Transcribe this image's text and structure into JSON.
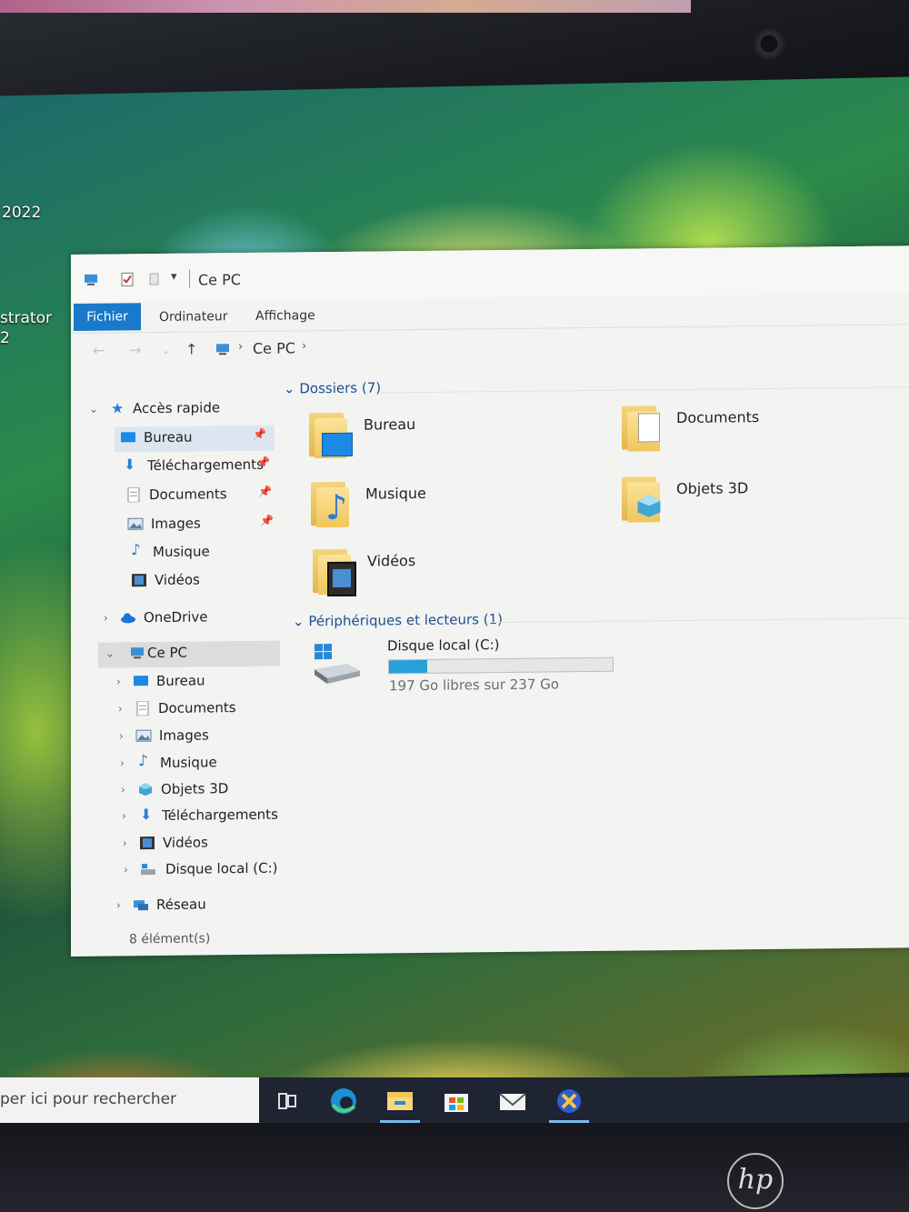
{
  "desktop": {
    "text1": "2022",
    "text2": "strator",
    "text3": "2"
  },
  "window": {
    "title": "Ce PC",
    "ribbon_tabs": [
      "Fichier",
      "Ordinateur",
      "Affichage"
    ],
    "breadcrumb": "Ce PC"
  },
  "nav": {
    "quick_access": "Accès rapide",
    "qa_items": [
      "Bureau",
      "Téléchargements",
      "Documents",
      "Images",
      "Musique",
      "Vidéos"
    ],
    "onedrive": "OneDrive",
    "this_pc": "Ce PC",
    "pc_items": [
      "Bureau",
      "Documents",
      "Images",
      "Musique",
      "Objets 3D",
      "Téléchargements",
      "Vidéos",
      "Disque local (C:)"
    ],
    "network": "Réseau"
  },
  "content": {
    "folders_header": "Dossiers (7)",
    "folders": [
      "Bureau",
      "Documents",
      "Musique",
      "Objets 3D",
      "Vidéos"
    ],
    "devices_header": "Périphériques et lecteurs (1)",
    "drive": {
      "name": "Disque local (C:)",
      "free_text": "197 Go libres sur 237 Go",
      "used_fraction": 0.17
    }
  },
  "status": {
    "items": "8 élément(s)"
  },
  "taskbar": {
    "search_placeholder": "per ici pour rechercher"
  },
  "brand": "hp",
  "colors": {
    "accent": "#1979ca",
    "header_blue": "#1d4f91",
    "drive_fill": "#26a0da"
  }
}
